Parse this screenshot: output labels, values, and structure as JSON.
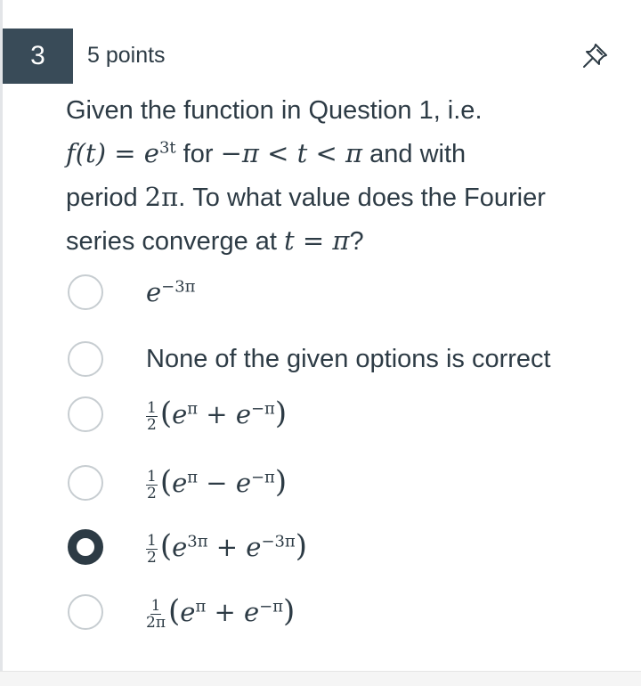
{
  "question": {
    "number": "3",
    "points": "5 points",
    "stem": {
      "line1": "Given the function in Question 1, i.e.",
      "f_of_t": "f(t)",
      "equals": " = ",
      "exp_base": "e",
      "exp_power": "3t",
      "for_text": " for ",
      "range": "−π < t < π",
      "and_with": " and with",
      "period_text": "period ",
      "period_value": "2π",
      "rest_line3": ". To what value does the Fourier",
      "line4_text": "series converge at ",
      "line4_math": "t = π",
      "line4_end": "?"
    }
  },
  "icons": {
    "pin": "pin-icon"
  },
  "options": [
    {
      "label": "e^{-3π}",
      "base": "e",
      "power": "−3π",
      "selected": false
    },
    {
      "label": "None of the given options is correct",
      "selected": false
    },
    {
      "label": "1/2 (e^π + e^{-π})",
      "coef_num": "1",
      "coef_den": "2",
      "a": "π",
      "op": "+",
      "b": "−π",
      "selected": false
    },
    {
      "label": "1/2 (e^π − e^{-π})",
      "coef_num": "1",
      "coef_den": "2",
      "a": "π",
      "op": "−",
      "b": "−π",
      "selected": false
    },
    {
      "label": "1/2 (e^{3π} + e^{-3π})",
      "coef_num": "1",
      "coef_den": "2",
      "a": "3π",
      "op": "+",
      "b": "−3π",
      "selected": true
    },
    {
      "label": "1/(2π) (e^π + e^{-π})",
      "coef_num": "1",
      "coef_den": "2π",
      "a": "π",
      "op": "+",
      "b": "−π",
      "selected": false
    }
  ],
  "colors": {
    "badge_bg": "#394b58",
    "text": "#2d3b45",
    "radio_border": "#c7cdd1"
  }
}
